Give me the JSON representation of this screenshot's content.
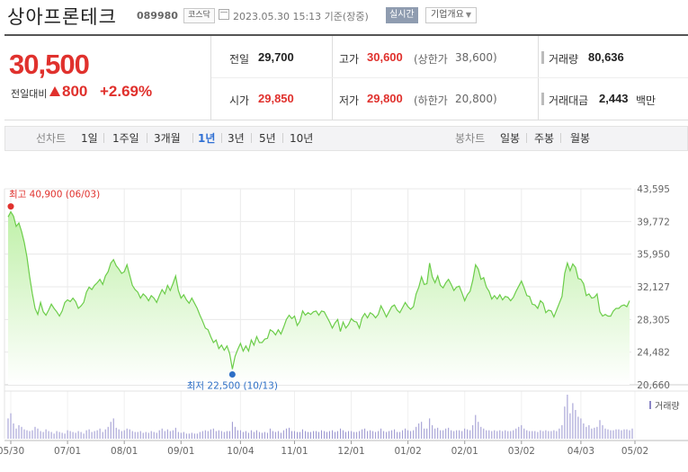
{
  "header": {
    "company": "상아프론테크",
    "code": "089980",
    "market": "코스닥",
    "datetime": "2023.05.30 15:13 기준(장중)",
    "realtime_label": "실시간",
    "overview_label": "기업개요"
  },
  "quote": {
    "price": "30,500",
    "change_label": "전일대비",
    "change": "800",
    "change_pct": "+2.69%",
    "up_color": "#e0312d"
  },
  "stats": {
    "prev_label": "전일",
    "prev": "29,700",
    "high_label": "고가",
    "high": "30,600",
    "upper_limit_label": "(상한가",
    "upper_limit": "38,600)",
    "volume_label": "거래량",
    "volume": "80,636",
    "open_label": "시가",
    "open": "29,850",
    "low_label": "저가",
    "low": "29,800",
    "lower_limit_label": "(하한가",
    "lower_limit": "20,800)",
    "amount_label": "거래대금",
    "amount": "2,443",
    "amount_unit": "백만"
  },
  "toolbar": {
    "line_label": "선차트",
    "periods": [
      "1일",
      "1주일",
      "3개월",
      "1년",
      "3년",
      "5년",
      "10년"
    ],
    "selected_period": "1년",
    "candle_label": "봉차트",
    "candles": [
      "일봉",
      "주봉",
      "월봉"
    ]
  },
  "chart_data": {
    "type": "area",
    "line_color": "#6ccd4a",
    "fill_color": "#d8f5c6",
    "y_ticks": [
      "43,595",
      "39,772",
      "35,950",
      "32,127",
      "28,305",
      "24,482",
      "20,660"
    ],
    "ylim": [
      20660,
      43595
    ],
    "x_ticks": [
      "05/30",
      "07/01",
      "08/01",
      "09/01",
      "10/04",
      "11/01",
      "12/01",
      "01/02",
      "02/01",
      "03/02",
      "04/03",
      "05/02"
    ],
    "high_label": "최고 40,900 (06/03)",
    "low_label": "최저 22,500 (10/13)",
    "volume_label": "거래량",
    "series": [
      {
        "values": [
          40300,
          40900,
          40400,
          39200,
          39600,
          38600,
          37300,
          35600,
          33300,
          31300,
          29600,
          28900,
          30300,
          29200,
          28800,
          29400,
          30100,
          29600,
          29200,
          28700,
          29300,
          30300,
          30600,
          30400,
          30800,
          30400,
          29600,
          29900,
          30300,
          31500,
          32100,
          31800,
          32300,
          32600,
          33000,
          32400,
          33400,
          33900,
          34900,
          35300,
          34600,
          34200,
          33700,
          33900,
          34700,
          33500,
          32300,
          31800,
          31500,
          30800,
          31300,
          31000,
          30500,
          31100,
          30800,
          30300,
          31100,
          31800,
          31300,
          32300,
          31700,
          32500,
          33400,
          31700,
          30800,
          31200,
          30600,
          30200,
          30800,
          30200,
          29600,
          28800,
          28100,
          27300,
          27100,
          26300,
          25600,
          25900,
          24900,
          25300,
          24700,
          25200,
          24300,
          22500,
          24000,
          24800,
          25500,
          24600,
          25200,
          24600,
          25900,
          25300,
          26300,
          25600,
          25600,
          26000,
          26100,
          27100,
          26900,
          26500,
          27100,
          26600,
          27400,
          28300,
          28800,
          28400,
          28700,
          27600,
          28100,
          29300,
          28800,
          29100,
          28900,
          29200,
          29300,
          28800,
          29300,
          29200,
          28600,
          28000,
          27300,
          27900,
          28300,
          26900,
          28000,
          27300,
          27700,
          28400,
          28100,
          28000,
          27300,
          28500,
          29000,
          28500,
          29100,
          28900,
          28500,
          28900,
          29900,
          29300,
          28600,
          29200,
          29800,
          30000,
          29400,
          29100,
          29700,
          30300,
          29800,
          29500,
          29800,
          31300,
          32100,
          33300,
          32400,
          32500,
          34900,
          33300,
          32600,
          33400,
          32300,
          32000,
          32600,
          33000,
          32400,
          31700,
          32100,
          32200,
          31400,
          30500,
          31200,
          31600,
          32900,
          34700,
          34200,
          33000,
          33200,
          32100,
          31600,
          30700,
          31100,
          30700,
          31200,
          30600,
          31000,
          30900,
          30500,
          30900,
          31600,
          32200,
          32800,
          32000,
          31100,
          31000,
          30100,
          30000,
          29600,
          30500,
          30200,
          29100,
          29400,
          29300,
          28600,
          29400,
          30200,
          31000,
          33700,
          34900,
          34000,
          34800,
          34400,
          33100,
          33000,
          32500,
          31100,
          31300,
          30800,
          30900,
          31300,
          29200,
          28700,
          28900,
          28700,
          28700,
          29300,
          29600,
          29600,
          29900,
          30000,
          29800,
          30500
        ]
      }
    ],
    "volume": [
      24,
      30,
      18,
      12,
      16,
      14,
      11,
      10,
      9,
      10,
      14,
      12,
      9,
      8,
      11,
      9,
      8,
      6,
      9,
      8,
      7,
      6,
      10,
      9,
      8,
      7,
      9,
      8,
      6,
      10,
      11,
      8,
      9,
      10,
      12,
      8,
      11,
      14,
      20,
      24,
      13,
      11,
      9,
      10,
      12,
      11,
      9,
      8,
      8,
      9,
      7,
      8,
      7,
      9,
      8,
      7,
      10,
      12,
      9,
      11,
      9,
      10,
      13,
      8,
      7,
      8,
      6,
      6,
      7,
      6,
      6,
      8,
      9,
      10,
      9,
      11,
      12,
      9,
      10,
      9,
      8,
      9,
      9,
      20,
      14,
      10,
      10,
      8,
      9,
      7,
      10,
      8,
      10,
      8,
      7,
      8,
      7,
      12,
      9,
      8,
      9,
      7,
      10,
      12,
      13,
      9,
      9,
      8,
      8,
      11,
      9,
      8,
      8,
      9,
      9,
      8,
      10,
      9,
      8,
      9,
      10,
      8,
      9,
      12,
      10,
      8,
      9,
      9,
      8,
      8,
      9,
      11,
      12,
      9,
      10,
      9,
      8,
      9,
      12,
      9,
      8,
      9,
      10,
      11,
      8,
      8,
      10,
      12,
      10,
      9,
      10,
      14,
      18,
      20,
      12,
      12,
      24,
      16,
      12,
      13,
      10,
      10,
      12,
      13,
      10,
      9,
      10,
      10,
      9,
      12,
      11,
      10,
      16,
      28,
      20,
      14,
      12,
      10,
      10,
      9,
      10,
      9,
      10,
      9,
      10,
      9,
      9,
      10,
      12,
      14,
      16,
      12,
      10,
      9,
      9,
      9,
      8,
      10,
      9,
      10,
      9,
      9,
      10,
      9,
      12,
      16,
      38,
      52,
      30,
      42,
      34,
      26,
      24,
      18,
      14,
      16,
      12,
      13,
      14,
      22,
      16,
      12,
      11,
      10,
      10,
      11,
      11,
      10,
      11,
      11,
      10,
      12
    ]
  }
}
